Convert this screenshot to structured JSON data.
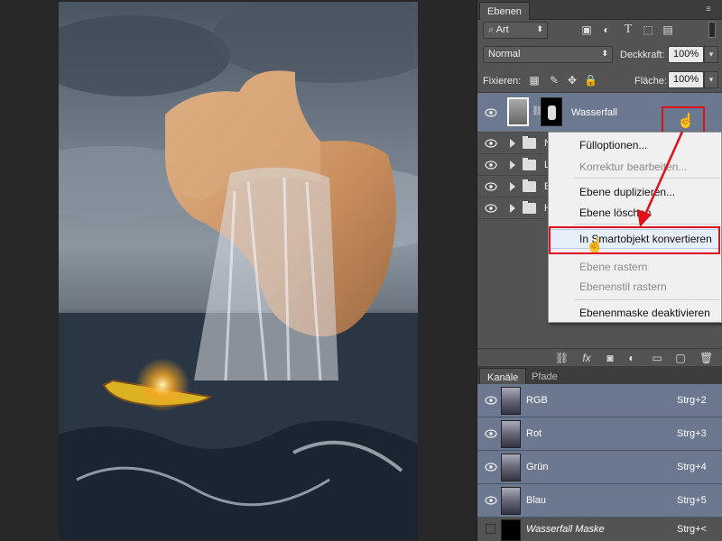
{
  "layers_panel": {
    "tab_label": "Ebenen",
    "filter_value": "Art",
    "blend_mode": "Normal",
    "opacity_label": "Deckkraft:",
    "opacity_value": "100%",
    "lock_label": "Fixieren:",
    "fill_label": "Fläche:",
    "fill_value": "100%",
    "selected_layer_name": "Wasserfall",
    "group_layers": [
      {
        "name": "N"
      },
      {
        "name": "L"
      },
      {
        "name": "E"
      },
      {
        "name": "H"
      }
    ]
  },
  "context_menu": {
    "items": [
      {
        "label": "Fülloptionen...",
        "enabled": true
      },
      {
        "label": "Korrektur bearbeiten...",
        "enabled": false
      },
      {
        "label": "Ebene duplizieren...",
        "enabled": true
      },
      {
        "label": "Ebene löschen",
        "enabled": true
      },
      {
        "label": "In Smartobjekt konvertieren",
        "enabled": true,
        "highlighted": true
      },
      {
        "label": "Ebene rastern",
        "enabled": false
      },
      {
        "label": "Ebenenstil rastern",
        "enabled": false
      },
      {
        "label": "Ebenenmaske deaktivieren",
        "enabled": true
      }
    ]
  },
  "channels_panel": {
    "tabs": [
      "Kanäle",
      "Pfade"
    ],
    "channels": [
      {
        "name": "RGB",
        "shortcut": "Strg+2"
      },
      {
        "name": "Rot",
        "shortcut": "Strg+3"
      },
      {
        "name": "Grün",
        "shortcut": "Strg+4"
      },
      {
        "name": "Blau",
        "shortcut": "Strg+5"
      }
    ],
    "mask_channel": {
      "name": "Wasserfall Maske",
      "shortcut": "Strg+<"
    }
  },
  "colors": {
    "annotation_red": "#e0101a",
    "panel_bg": "#535353",
    "selected_row": "#6c7890"
  }
}
